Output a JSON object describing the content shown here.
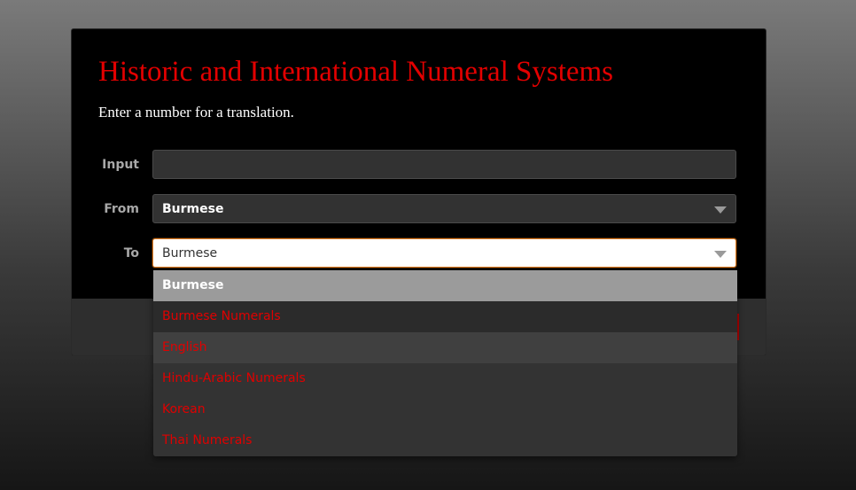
{
  "header": {
    "title": "Historic and International Numeral Systems",
    "subtitle": "Enter a number for a translation."
  },
  "form": {
    "input_label": "Input",
    "input_value": "",
    "from_label": "From",
    "from_value": "Burmese",
    "to_label": "To",
    "to_value": "Burmese"
  },
  "dropdown": {
    "options": [
      "Burmese",
      "Burmese Numerals",
      "English",
      "Hindu-Arabic Numerals",
      "Korean",
      "Thai Numerals"
    ],
    "selected": "Burmese"
  },
  "colors": {
    "accent": "#e30000",
    "focus_border": "#e07b1f",
    "panel_bg": "#000000",
    "field_bg": "#323232"
  }
}
